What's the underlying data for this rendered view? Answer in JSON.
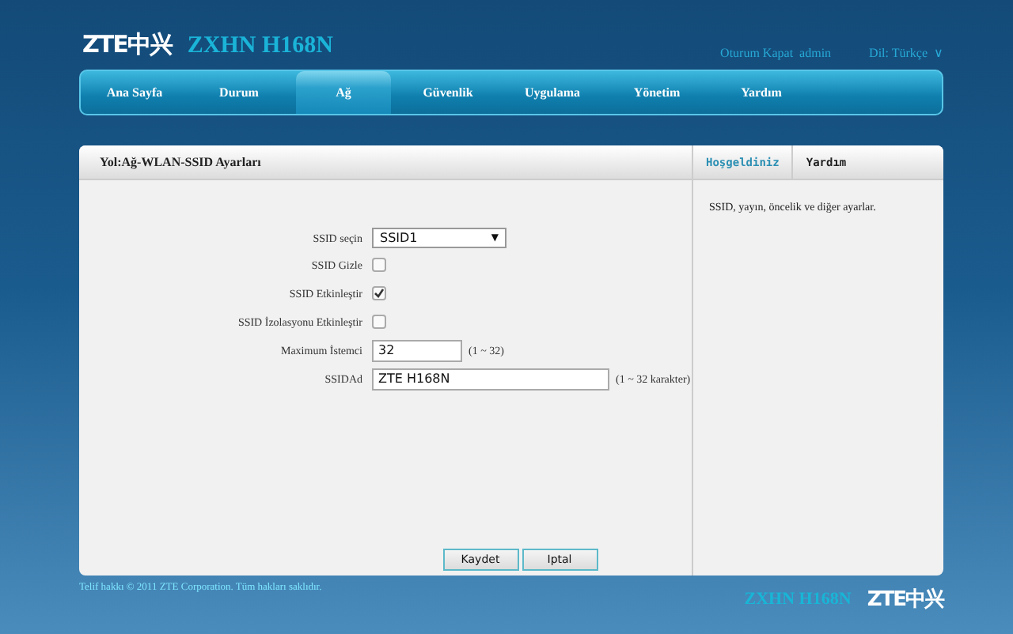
{
  "header": {
    "logo": "ZTE中兴",
    "model": "ZXHN H168N",
    "logout": "Oturum Kapat",
    "user": "admin",
    "language": "Dil: Türkçe",
    "language_caret": "∨"
  },
  "tabs": [
    {
      "label": "Ana Sayfa",
      "selected": false
    },
    {
      "label": "Durum",
      "selected": false
    },
    {
      "label": "Ağ",
      "selected": true
    },
    {
      "label": "Güvenlik",
      "selected": false
    },
    {
      "label": "Uygulama",
      "selected": false
    },
    {
      "label": "Yönetim",
      "selected": false
    },
    {
      "label": "Yardım",
      "selected": false
    }
  ],
  "breadcrumb": "Yol:Ağ-WLAN-SSID Ayarları",
  "form": [
    {
      "kind": "select",
      "label": "SSID seçin",
      "value": "SSID1",
      "caret": "▼"
    },
    {
      "kind": "checkbox",
      "label": "SSID Gizle",
      "checked": false
    },
    {
      "kind": "checkbox",
      "label": "SSID Etkinleştir",
      "checked": true
    },
    {
      "kind": "checkbox",
      "label": "SSID İzolasyonu Etkinleştir",
      "checked": false
    },
    {
      "kind": "text",
      "label": "Maximum İstemci",
      "value": "32",
      "hint": "(1 ~ 32)"
    },
    {
      "kind": "text",
      "label": "SSIDAd",
      "value": "ZTE H168N",
      "hint": "(1 ~ 32 karakter)"
    }
  ],
  "buttons": [
    "Kaydet",
    "Iptal"
  ],
  "side_tabs": [
    {
      "label": "Hoşgeldiniz",
      "selected": true
    },
    {
      "label": "Yardım",
      "selected": false
    }
  ],
  "help_text": "SSID, yayın, öncelik ve diğer ayarlar.",
  "footer": {
    "copyright": "Telif hakkı © 2011 ZTE Corporation. Tüm hakları saklıdır.",
    "model": "ZXHN H168N",
    "logo": "ZTE中兴"
  }
}
